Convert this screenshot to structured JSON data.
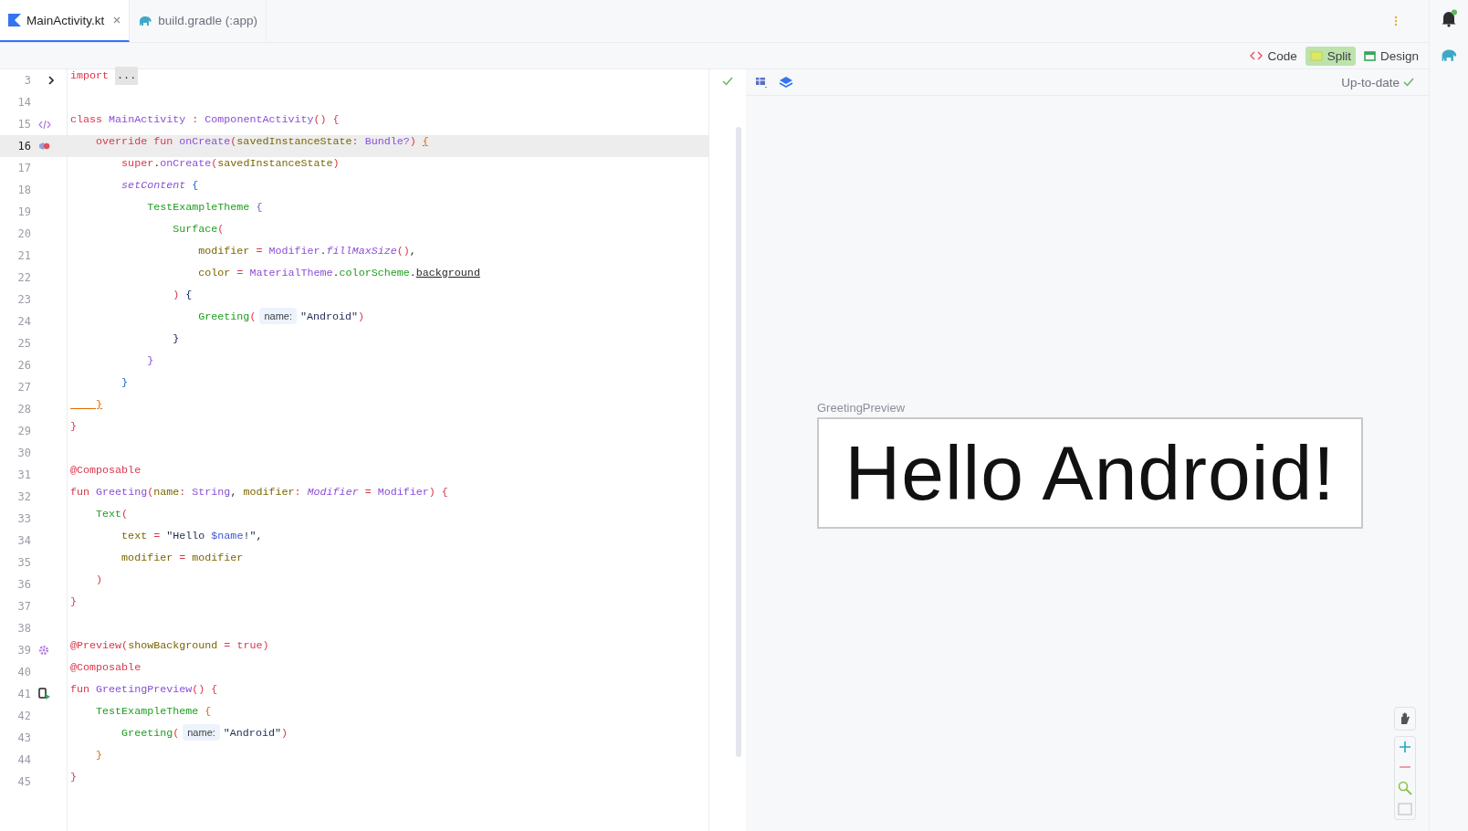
{
  "tabs": [
    {
      "label": "MainActivity.kt",
      "kind": "kotlin",
      "selected": true,
      "closable": true
    },
    {
      "label": "build.gradle (:app)",
      "kind": "gradle",
      "selected": false,
      "closable": false
    }
  ],
  "view_modes": [
    {
      "label": "Code",
      "kind": "code",
      "selected": false
    },
    {
      "label": "Split",
      "kind": "split",
      "selected": true
    },
    {
      "label": "Design",
      "kind": "design",
      "selected": false
    }
  ],
  "editor": {
    "lines": [
      {
        "number": "3",
        "kind": "fold",
        "current": false,
        "tokens": [
          {
            "kind": "keyword",
            "text": "import "
          },
          {
            "kind": "folded",
            "text": "..."
          }
        ]
      },
      {
        "number": "14",
        "kind": "plain",
        "current": false
      },
      {
        "number": "15",
        "kind": "implements",
        "current": false,
        "tokens": [
          {
            "kind": "keyword",
            "text": "class "
          },
          {
            "kind": "name",
            "text": "MainActivity"
          },
          {
            "kind": "punct",
            "text": " : "
          },
          {
            "kind": "name",
            "text": "ComponentActivity"
          },
          {
            "kind": "punct",
            "text": "() {"
          }
        ]
      },
      {
        "number": "16",
        "kind": "override",
        "current": true,
        "tokens": [
          {
            "kind": "keyword",
            "text": "    override fun "
          },
          {
            "kind": "name",
            "text": "onCreate"
          },
          {
            "kind": "punct",
            "text": "("
          },
          {
            "kind": "param",
            "text": "savedInstanceState"
          },
          {
            "kind": "punct",
            "text": ": "
          },
          {
            "kind": "name",
            "text": "Bundle?"
          },
          {
            "kind": "punct",
            "text": ") "
          },
          {
            "kind": "match_brace",
            "text": "{"
          }
        ]
      },
      {
        "number": "17",
        "kind": "plain",
        "current": false,
        "tokens": [
          {
            "kind": "keyword",
            "text": "        super"
          },
          {
            "kind": "plain",
            "text": "."
          },
          {
            "kind": "name",
            "text": "onCreate"
          },
          {
            "kind": "punct",
            "text": "("
          },
          {
            "kind": "param",
            "text": "savedInstanceState"
          },
          {
            "kind": "punct",
            "text": ")"
          }
        ]
      },
      {
        "number": "18",
        "kind": "plain",
        "current": false,
        "tokens": [
          {
            "kind": "italic_name",
            "text": "        setContent "
          },
          {
            "kind": "brace_blue",
            "text": "{"
          }
        ]
      },
      {
        "number": "19",
        "kind": "plain",
        "current": false,
        "tokens": [
          {
            "kind": "call",
            "text": "            TestExampleTheme "
          },
          {
            "kind": "brace_purple",
            "text": "{"
          }
        ]
      },
      {
        "number": "20",
        "kind": "plain",
        "current": false,
        "tokens": [
          {
            "kind": "call",
            "text": "                Surface"
          },
          {
            "kind": "punct",
            "text": "("
          }
        ]
      },
      {
        "number": "21",
        "kind": "plain",
        "current": false,
        "tokens": [
          {
            "kind": "param",
            "text": "                    modifier "
          },
          {
            "kind": "punct",
            "text": "= "
          },
          {
            "kind": "name",
            "text": "Modifier"
          },
          {
            "kind": "plain",
            "text": "."
          },
          {
            "kind": "italic_name",
            "text": "fillMaxSize"
          },
          {
            "kind": "punct",
            "text": "()"
          },
          {
            "kind": "plain",
            "text": ","
          }
        ]
      },
      {
        "number": "22",
        "kind": "plain",
        "current": false,
        "tokens": [
          {
            "kind": "param",
            "text": "                    color "
          },
          {
            "kind": "punct",
            "text": "= "
          },
          {
            "kind": "name",
            "text": "MaterialTheme"
          },
          {
            "kind": "plain",
            "text": "."
          },
          {
            "kind": "call",
            "text": "colorScheme"
          },
          {
            "kind": "plain",
            "text": "."
          },
          {
            "kind": "underlined",
            "text": "background"
          }
        ]
      },
      {
        "number": "23",
        "kind": "plain",
        "current": false,
        "tokens": [
          {
            "kind": "punct",
            "text": "                ) "
          },
          {
            "kind": "brace_navy",
            "text": "{"
          }
        ]
      },
      {
        "number": "24",
        "kind": "plain",
        "current": false,
        "tokens": [
          {
            "kind": "call",
            "text": "                    Greeting"
          },
          {
            "kind": "punct",
            "text": "("
          },
          {
            "kind": "hint",
            "text": "name:"
          },
          {
            "kind": "string",
            "text": "\"Android\""
          },
          {
            "kind": "punct",
            "text": ")"
          }
        ]
      },
      {
        "number": "25",
        "kind": "plain",
        "current": false,
        "tokens": [
          {
            "kind": "brace_navy",
            "text": "                }"
          }
        ]
      },
      {
        "number": "26",
        "kind": "plain",
        "current": false,
        "tokens": [
          {
            "kind": "brace_purple",
            "text": "            }"
          }
        ]
      },
      {
        "number": "27",
        "kind": "plain",
        "current": false,
        "tokens": [
          {
            "kind": "brace_blue",
            "text": "        }"
          }
        ]
      },
      {
        "number": "28",
        "kind": "plain",
        "current": false,
        "tokens": [
          {
            "kind": "match_brace",
            "text": "    }"
          }
        ]
      },
      {
        "number": "29",
        "kind": "plain",
        "current": false,
        "tokens": [
          {
            "kind": "punct",
            "text": "}"
          }
        ]
      },
      {
        "number": "30",
        "kind": "plain",
        "current": false
      },
      {
        "number": "31",
        "kind": "plain",
        "current": false,
        "tokens": [
          {
            "kind": "keyword",
            "text": "@Composable"
          }
        ]
      },
      {
        "number": "32",
        "kind": "plain",
        "current": false,
        "tokens": [
          {
            "kind": "keyword",
            "text": "fun "
          },
          {
            "kind": "name",
            "text": "Greeting"
          },
          {
            "kind": "punct",
            "text": "("
          },
          {
            "kind": "param",
            "text": "name"
          },
          {
            "kind": "punct",
            "text": ": "
          },
          {
            "kind": "name",
            "text": "String"
          },
          {
            "kind": "plain",
            "text": ", "
          },
          {
            "kind": "param",
            "text": "modifier"
          },
          {
            "kind": "punct",
            "text": ": "
          },
          {
            "kind": "italic_name",
            "text": "Modifier "
          },
          {
            "kind": "punct",
            "text": "= "
          },
          {
            "kind": "name",
            "text": "Modifier"
          },
          {
            "kind": "punct",
            "text": ") {"
          }
        ]
      },
      {
        "number": "33",
        "kind": "plain",
        "current": false,
        "tokens": [
          {
            "kind": "call",
            "text": "    Text"
          },
          {
            "kind": "punct",
            "text": "("
          }
        ]
      },
      {
        "number": "34",
        "kind": "plain",
        "current": false,
        "tokens": [
          {
            "kind": "param",
            "text": "        text "
          },
          {
            "kind": "punct",
            "text": "= "
          },
          {
            "kind": "string",
            "text": "\"Hello "
          },
          {
            "kind": "template",
            "text": "$name"
          },
          {
            "kind": "string",
            "text": "!\""
          },
          {
            "kind": "plain",
            "text": ","
          }
        ]
      },
      {
        "number": "35",
        "kind": "plain",
        "current": false,
        "tokens": [
          {
            "kind": "param",
            "text": "        modifier "
          },
          {
            "kind": "punct",
            "text": "= "
          },
          {
            "kind": "param",
            "text": "modifier"
          }
        ]
      },
      {
        "number": "36",
        "kind": "plain",
        "current": false,
        "tokens": [
          {
            "kind": "punct",
            "text": "    )"
          }
        ]
      },
      {
        "number": "37",
        "kind": "plain",
        "current": false,
        "tokens": [
          {
            "kind": "punct",
            "text": "}"
          }
        ]
      },
      {
        "number": "38",
        "kind": "plain",
        "current": false
      },
      {
        "number": "39",
        "kind": "gear",
        "current": false,
        "tokens": [
          {
            "kind": "keyword",
            "text": "@Preview"
          },
          {
            "kind": "punct",
            "text": "("
          },
          {
            "kind": "param",
            "text": "showBackground "
          },
          {
            "kind": "punct",
            "text": "= "
          },
          {
            "kind": "keyword",
            "text": "true"
          },
          {
            "kind": "punct",
            "text": ")"
          }
        ]
      },
      {
        "number": "40",
        "kind": "plain",
        "current": false,
        "tokens": [
          {
            "kind": "keyword",
            "text": "@Composable"
          }
        ]
      },
      {
        "number": "41",
        "kind": "run",
        "current": false,
        "tokens": [
          {
            "kind": "keyword",
            "text": "fun "
          },
          {
            "kind": "name",
            "text": "GreetingPreview"
          },
          {
            "kind": "punct",
            "text": "() {"
          }
        ]
      },
      {
        "number": "42",
        "kind": "plain",
        "current": false,
        "tokens": [
          {
            "kind": "call",
            "text": "    TestExampleTheme "
          },
          {
            "kind": "brace_orange",
            "text": "{"
          }
        ]
      },
      {
        "number": "43",
        "kind": "plain",
        "current": false,
        "tokens": [
          {
            "kind": "call",
            "text": "        Greeting"
          },
          {
            "kind": "punct",
            "text": "("
          },
          {
            "kind": "hint",
            "text": "name:"
          },
          {
            "kind": "string",
            "text": "\"Android\""
          },
          {
            "kind": "punct",
            "text": ")"
          }
        ]
      },
      {
        "number": "44",
        "kind": "plain",
        "current": false,
        "tokens": [
          {
            "kind": "brace_orange",
            "text": "    }"
          }
        ]
      },
      {
        "number": "45",
        "kind": "plain",
        "current": false,
        "tokens": [
          {
            "kind": "punct",
            "text": "}"
          }
        ]
      }
    ]
  },
  "preview": {
    "status": "Up-to-date",
    "title": "GreetingPreview",
    "text": "Hello Android!"
  }
}
